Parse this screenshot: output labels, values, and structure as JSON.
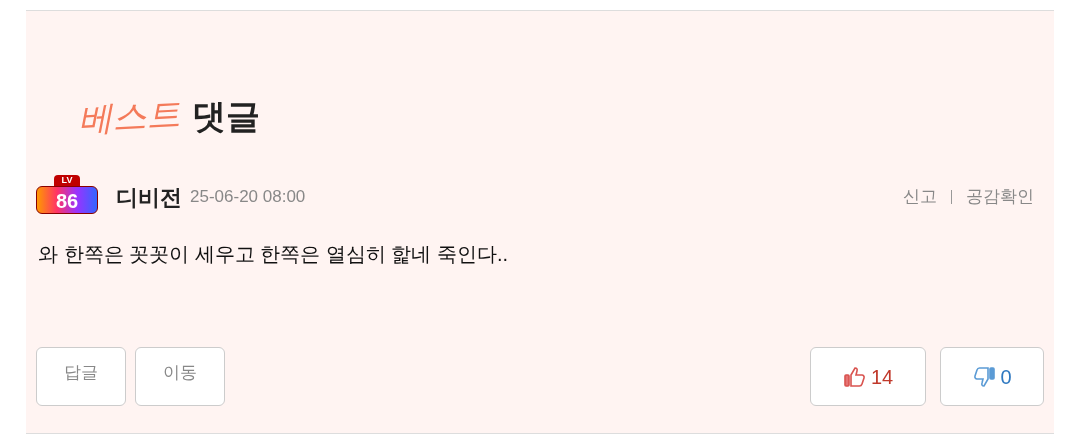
{
  "title": {
    "part_1": "베스트",
    "part_2": "댓글"
  },
  "comment": {
    "level_badge": {
      "label": "LV",
      "level": "86"
    },
    "author": "디비전",
    "date": "25-06-20 08:00",
    "actions": [
      "신고",
      "공감확인"
    ],
    "text": "와 한쪽은 꼿꼿이 세우고 한쪽은 열심히 핥네 죽인다..",
    "buttons": [
      "답글",
      "이동"
    ],
    "like": {
      "count": "14"
    },
    "dislike": {
      "count": "0"
    }
  }
}
